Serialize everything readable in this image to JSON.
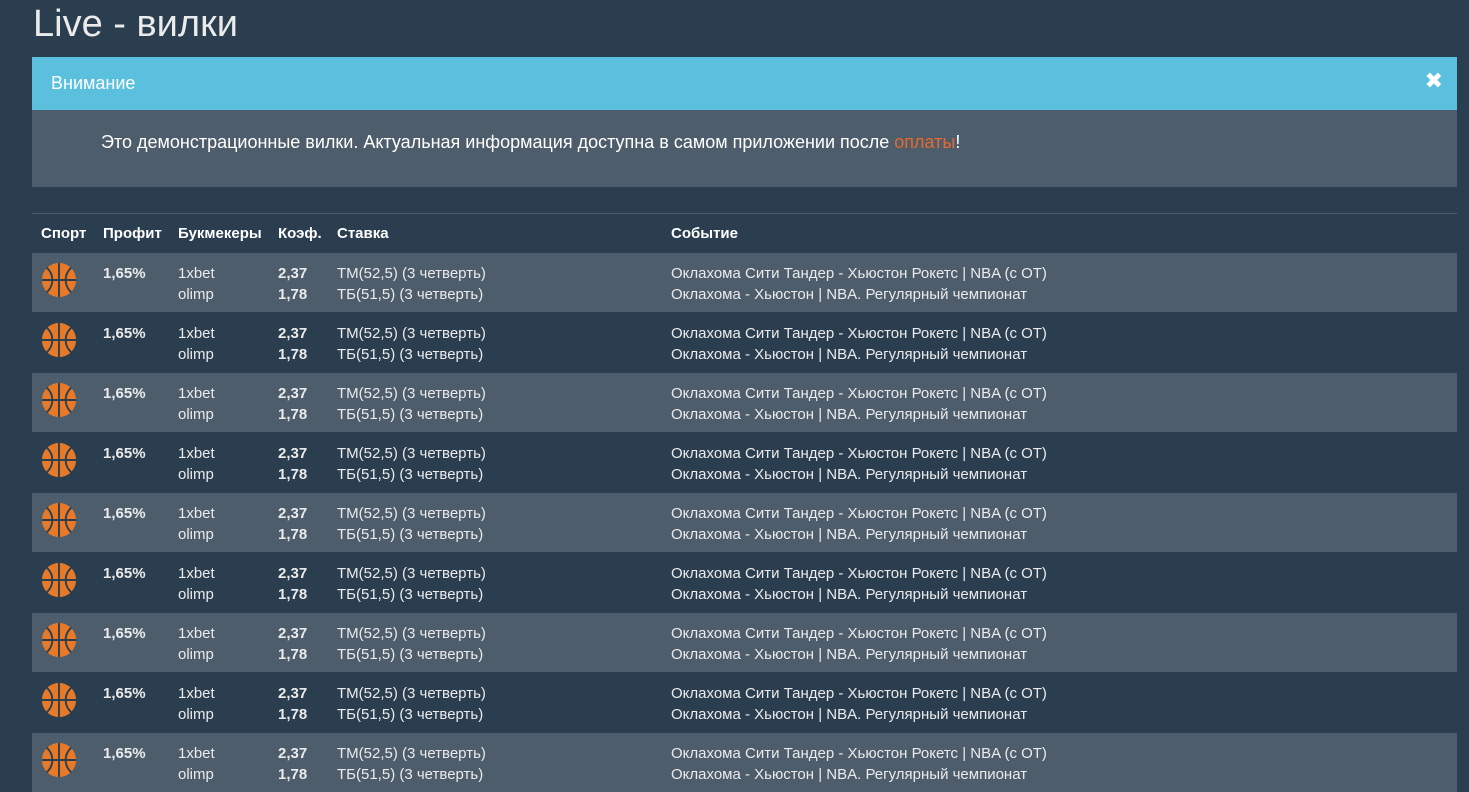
{
  "header": {
    "title": "Live - вилки"
  },
  "alert": {
    "title": "Внимание",
    "close_glyph": "✖",
    "message_before": "Это демонстрационные вилки. Актуальная информация доступна в самом приложении после ",
    "link_label": "оплаты",
    "message_after": "!"
  },
  "table": {
    "columns": {
      "sport": "Спорт",
      "profit": "Профит",
      "bookmakers": "Букмекеры",
      "odds": "Коэф.",
      "bet": "Ставка",
      "event": "Событие"
    }
  },
  "colors": {
    "accent": "#5bc0de",
    "link": "#e56a2b",
    "ball": "#e67a28"
  },
  "rows": [
    {
      "sport_icon": "basketball-icon",
      "profit": "1,65%",
      "bookmakers": [
        "1xbet",
        "olimp"
      ],
      "odds": [
        "2,37",
        "1,78"
      ],
      "bets": [
        "ТМ(52,5) (3 четверть)",
        "ТБ(51,5) (3 четверть)"
      ],
      "events": [
        "Оклахома Сити Тандер - Хьюстон Рокетс | NBA (с ОТ)",
        "Оклахома - Хьюстон | NBA. Регулярный чемпионат"
      ]
    },
    {
      "sport_icon": "basketball-icon",
      "profit": "1,65%",
      "bookmakers": [
        "1xbet",
        "olimp"
      ],
      "odds": [
        "2,37",
        "1,78"
      ],
      "bets": [
        "ТМ(52,5) (3 четверть)",
        "ТБ(51,5) (3 четверть)"
      ],
      "events": [
        "Оклахома Сити Тандер - Хьюстон Рокетс | NBA (с ОТ)",
        "Оклахома - Хьюстон | NBA. Регулярный чемпионат"
      ]
    },
    {
      "sport_icon": "basketball-icon",
      "profit": "1,65%",
      "bookmakers": [
        "1xbet",
        "olimp"
      ],
      "odds": [
        "2,37",
        "1,78"
      ],
      "bets": [
        "ТМ(52,5) (3 четверть)",
        "ТБ(51,5) (3 четверть)"
      ],
      "events": [
        "Оклахома Сити Тандер - Хьюстон Рокетс | NBA (с ОТ)",
        "Оклахома - Хьюстон | NBA. Регулярный чемпионат"
      ]
    },
    {
      "sport_icon": "basketball-icon",
      "profit": "1,65%",
      "bookmakers": [
        "1xbet",
        "olimp"
      ],
      "odds": [
        "2,37",
        "1,78"
      ],
      "bets": [
        "ТМ(52,5) (3 четверть)",
        "ТБ(51,5) (3 четверть)"
      ],
      "events": [
        "Оклахома Сити Тандер - Хьюстон Рокетс | NBA (с ОТ)",
        "Оклахома - Хьюстон | NBA. Регулярный чемпионат"
      ]
    },
    {
      "sport_icon": "basketball-icon",
      "profit": "1,65%",
      "bookmakers": [
        "1xbet",
        "olimp"
      ],
      "odds": [
        "2,37",
        "1,78"
      ],
      "bets": [
        "ТМ(52,5) (3 четверть)",
        "ТБ(51,5) (3 четверть)"
      ],
      "events": [
        "Оклахома Сити Тандер - Хьюстон Рокетс | NBA (с ОТ)",
        "Оклахома - Хьюстон | NBA. Регулярный чемпионат"
      ]
    },
    {
      "sport_icon": "basketball-icon",
      "profit": "1,65%",
      "bookmakers": [
        "1xbet",
        "olimp"
      ],
      "odds": [
        "2,37",
        "1,78"
      ],
      "bets": [
        "ТМ(52,5) (3 четверть)",
        "ТБ(51,5) (3 четверть)"
      ],
      "events": [
        "Оклахома Сити Тандер - Хьюстон Рокетс | NBA (с ОТ)",
        "Оклахома - Хьюстон | NBA. Регулярный чемпионат"
      ]
    },
    {
      "sport_icon": "basketball-icon",
      "profit": "1,65%",
      "bookmakers": [
        "1xbet",
        "olimp"
      ],
      "odds": [
        "2,37",
        "1,78"
      ],
      "bets": [
        "ТМ(52,5) (3 четверть)",
        "ТБ(51,5) (3 четверть)"
      ],
      "events": [
        "Оклахома Сити Тандер - Хьюстон Рокетс | NBA (с ОТ)",
        "Оклахома - Хьюстон | NBA. Регулярный чемпионат"
      ]
    },
    {
      "sport_icon": "basketball-icon",
      "profit": "1,65%",
      "bookmakers": [
        "1xbet",
        "olimp"
      ],
      "odds": [
        "2,37",
        "1,78"
      ],
      "bets": [
        "ТМ(52,5) (3 четверть)",
        "ТБ(51,5) (3 четверть)"
      ],
      "events": [
        "Оклахома Сити Тандер - Хьюстон Рокетс | NBA (с ОТ)",
        "Оклахома - Хьюстон | NBA. Регулярный чемпионат"
      ]
    },
    {
      "sport_icon": "basketball-icon",
      "profit": "1,65%",
      "bookmakers": [
        "1xbet",
        "olimp"
      ],
      "odds": [
        "2,37",
        "1,78"
      ],
      "bets": [
        "ТМ(52,5) (3 четверть)",
        "ТБ(51,5) (3 четверть)"
      ],
      "events": [
        "Оклахома Сити Тандер - Хьюстон Рокетс | NBA (с ОТ)",
        "Оклахома - Хьюстон | NBA. Регулярный чемпионат"
      ]
    }
  ]
}
